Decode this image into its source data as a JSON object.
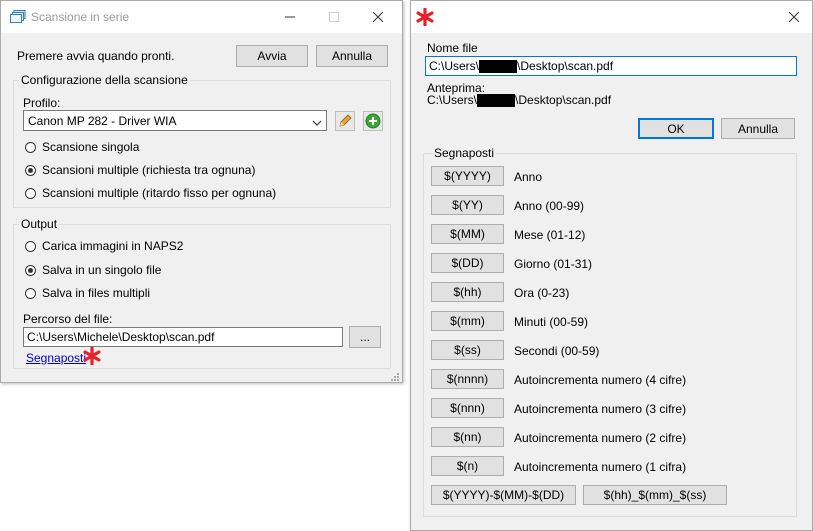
{
  "batch_window": {
    "title": "Scansione in serie",
    "ready_text": "Premere avvia quando pronti.",
    "start_button": "Avvia",
    "cancel_button": "Annulla",
    "scan_config": {
      "group_title": "Configurazione della scansione",
      "profile_label": "Profilo:",
      "profile_value": "Canon MP 282  - Driver WIA",
      "options": [
        {
          "label": "Scansione singola",
          "selected": false
        },
        {
          "label": "Scansioni multiple (richiesta tra ognuna)",
          "selected": true
        },
        {
          "label": "Scansioni multiple (ritardo fisso per ognuna)",
          "selected": false
        }
      ]
    },
    "output": {
      "group_title": "Output",
      "options": [
        {
          "label": "Carica immagini in NAPS2",
          "selected": false
        },
        {
          "label": "Salva in un singolo file",
          "selected": true
        },
        {
          "label": "Salva in files multipli",
          "selected": false
        }
      ],
      "path_label": "Percorso del file:",
      "path_value": "C:\\Users\\Michele\\Desktop\\scan.pdf",
      "browse_button": "...",
      "placeholders_link": "Segnaposti"
    }
  },
  "placeholder_window": {
    "filename_label": "Nome file",
    "filename_prefix": "C:\\Users\\",
    "filename_suffix": "\\Desktop\\scan.pdf",
    "preview_label": "Anteprima:",
    "preview_prefix": "C:\\Users\\",
    "preview_suffix": "\\Desktop\\scan.pdf",
    "ok_button": "OK",
    "cancel_button": "Annulla",
    "group_title": "Segnaposti",
    "placeholders": [
      {
        "token": "$(YYYY)",
        "label": "Anno"
      },
      {
        "token": "$(YY)",
        "label": "Anno (00-99)"
      },
      {
        "token": "$(MM)",
        "label": "Mese (01-12)"
      },
      {
        "token": "$(DD)",
        "label": "Giorno (01-31)"
      },
      {
        "token": "$(hh)",
        "label": "Ora (0-23)"
      },
      {
        "token": "$(mm)",
        "label": "Minuti (00-59)"
      },
      {
        "token": "$(ss)",
        "label": "Secondi (00-59)"
      },
      {
        "token": "$(nnnn)",
        "label": "Autoincrementa numero (4 cifre)"
      },
      {
        "token": "$(nnn)",
        "label": "Autoincrementa numero (3 cifre)"
      },
      {
        "token": "$(nn)",
        "label": "Autoincrementa numero (2 cifre)"
      },
      {
        "token": "$(n)",
        "label": "Autoincrementa numero (1 cifra)"
      }
    ],
    "combo_date": "$(YYYY)-$(MM)-$(DD)",
    "combo_time": "$(hh)_$(mm)_$(ss)"
  },
  "colors": {
    "window_bg": "#f0f0f0",
    "focus_blue": "#0078d7",
    "link_blue": "#0000cc",
    "star_red": "#e8202a",
    "add_green": "#3aa63a",
    "pencil_orange": "#e8a23a"
  },
  "icons": [
    "batch-scan-app-icon",
    "minimize-icon",
    "maximize-icon",
    "close-icon",
    "chevron-down-icon",
    "edit-pencil-icon",
    "add-plus-icon",
    "resize-grip-icon",
    "red-asterisk-icon"
  ]
}
